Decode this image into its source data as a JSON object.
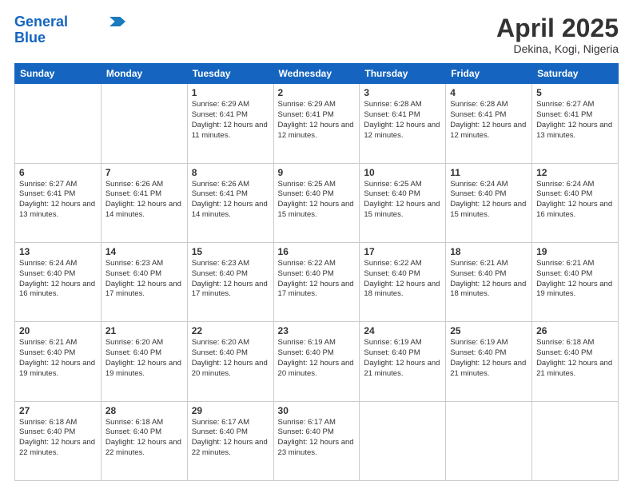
{
  "logo": {
    "line1": "General",
    "line2": "Blue"
  },
  "title": "April 2025",
  "location": "Dekina, Kogi, Nigeria",
  "days_of_week": [
    "Sunday",
    "Monday",
    "Tuesday",
    "Wednesday",
    "Thursday",
    "Friday",
    "Saturday"
  ],
  "weeks": [
    [
      {
        "day": "",
        "info": ""
      },
      {
        "day": "",
        "info": ""
      },
      {
        "day": "1",
        "info": "Sunrise: 6:29 AM\nSunset: 6:41 PM\nDaylight: 12 hours and 11 minutes."
      },
      {
        "day": "2",
        "info": "Sunrise: 6:29 AM\nSunset: 6:41 PM\nDaylight: 12 hours and 12 minutes."
      },
      {
        "day": "3",
        "info": "Sunrise: 6:28 AM\nSunset: 6:41 PM\nDaylight: 12 hours and 12 minutes."
      },
      {
        "day": "4",
        "info": "Sunrise: 6:28 AM\nSunset: 6:41 PM\nDaylight: 12 hours and 12 minutes."
      },
      {
        "day": "5",
        "info": "Sunrise: 6:27 AM\nSunset: 6:41 PM\nDaylight: 12 hours and 13 minutes."
      }
    ],
    [
      {
        "day": "6",
        "info": "Sunrise: 6:27 AM\nSunset: 6:41 PM\nDaylight: 12 hours and 13 minutes."
      },
      {
        "day": "7",
        "info": "Sunrise: 6:26 AM\nSunset: 6:41 PM\nDaylight: 12 hours and 14 minutes."
      },
      {
        "day": "8",
        "info": "Sunrise: 6:26 AM\nSunset: 6:41 PM\nDaylight: 12 hours and 14 minutes."
      },
      {
        "day": "9",
        "info": "Sunrise: 6:25 AM\nSunset: 6:40 PM\nDaylight: 12 hours and 15 minutes."
      },
      {
        "day": "10",
        "info": "Sunrise: 6:25 AM\nSunset: 6:40 PM\nDaylight: 12 hours and 15 minutes."
      },
      {
        "day": "11",
        "info": "Sunrise: 6:24 AM\nSunset: 6:40 PM\nDaylight: 12 hours and 15 minutes."
      },
      {
        "day": "12",
        "info": "Sunrise: 6:24 AM\nSunset: 6:40 PM\nDaylight: 12 hours and 16 minutes."
      }
    ],
    [
      {
        "day": "13",
        "info": "Sunrise: 6:24 AM\nSunset: 6:40 PM\nDaylight: 12 hours and 16 minutes."
      },
      {
        "day": "14",
        "info": "Sunrise: 6:23 AM\nSunset: 6:40 PM\nDaylight: 12 hours and 17 minutes."
      },
      {
        "day": "15",
        "info": "Sunrise: 6:23 AM\nSunset: 6:40 PM\nDaylight: 12 hours and 17 minutes."
      },
      {
        "day": "16",
        "info": "Sunrise: 6:22 AM\nSunset: 6:40 PM\nDaylight: 12 hours and 17 minutes."
      },
      {
        "day": "17",
        "info": "Sunrise: 6:22 AM\nSunset: 6:40 PM\nDaylight: 12 hours and 18 minutes."
      },
      {
        "day": "18",
        "info": "Sunrise: 6:21 AM\nSunset: 6:40 PM\nDaylight: 12 hours and 18 minutes."
      },
      {
        "day": "19",
        "info": "Sunrise: 6:21 AM\nSunset: 6:40 PM\nDaylight: 12 hours and 19 minutes."
      }
    ],
    [
      {
        "day": "20",
        "info": "Sunrise: 6:21 AM\nSunset: 6:40 PM\nDaylight: 12 hours and 19 minutes."
      },
      {
        "day": "21",
        "info": "Sunrise: 6:20 AM\nSunset: 6:40 PM\nDaylight: 12 hours and 19 minutes."
      },
      {
        "day": "22",
        "info": "Sunrise: 6:20 AM\nSunset: 6:40 PM\nDaylight: 12 hours and 20 minutes."
      },
      {
        "day": "23",
        "info": "Sunrise: 6:19 AM\nSunset: 6:40 PM\nDaylight: 12 hours and 20 minutes."
      },
      {
        "day": "24",
        "info": "Sunrise: 6:19 AM\nSunset: 6:40 PM\nDaylight: 12 hours and 21 minutes."
      },
      {
        "day": "25",
        "info": "Sunrise: 6:19 AM\nSunset: 6:40 PM\nDaylight: 12 hours and 21 minutes."
      },
      {
        "day": "26",
        "info": "Sunrise: 6:18 AM\nSunset: 6:40 PM\nDaylight: 12 hours and 21 minutes."
      }
    ],
    [
      {
        "day": "27",
        "info": "Sunrise: 6:18 AM\nSunset: 6:40 PM\nDaylight: 12 hours and 22 minutes."
      },
      {
        "day": "28",
        "info": "Sunrise: 6:18 AM\nSunset: 6:40 PM\nDaylight: 12 hours and 22 minutes."
      },
      {
        "day": "29",
        "info": "Sunrise: 6:17 AM\nSunset: 6:40 PM\nDaylight: 12 hours and 22 minutes."
      },
      {
        "day": "30",
        "info": "Sunrise: 6:17 AM\nSunset: 6:40 PM\nDaylight: 12 hours and 23 minutes."
      },
      {
        "day": "",
        "info": ""
      },
      {
        "day": "",
        "info": ""
      },
      {
        "day": "",
        "info": ""
      }
    ]
  ]
}
